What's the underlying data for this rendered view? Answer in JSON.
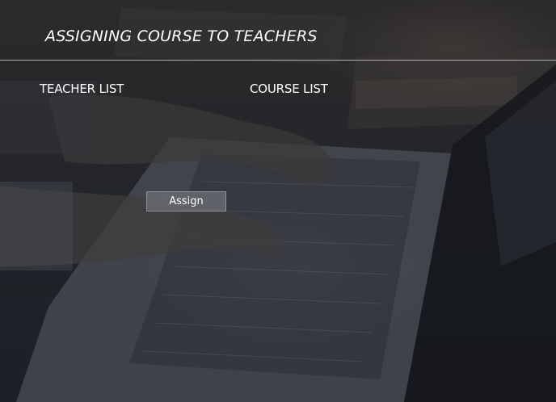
{
  "header": {
    "title": "ASSIGNING COURSE TO TEACHERS"
  },
  "lists": {
    "teacher_label": "TEACHER LIST",
    "course_label": "COURSE LIST"
  },
  "actions": {
    "assign_label": "Assign"
  },
  "colors": {
    "text": "#ffffff",
    "divider": "#dcdcdc",
    "button_bg": "#6e7076",
    "background": "#23252b"
  },
  "background_image": "photo of hands typing on a laptop keyboard"
}
